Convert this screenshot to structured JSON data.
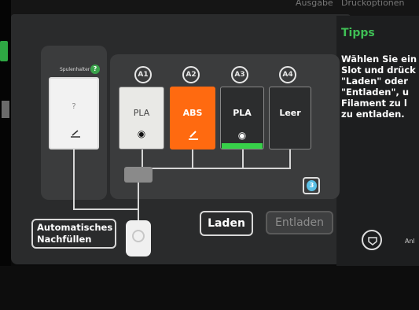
{
  "top": {
    "tab_left": "Ausgabe",
    "tab_right": "Druckoptionen"
  },
  "spool_holder": {
    "label": "Spulenhalter",
    "help": "?",
    "slot_label": "?"
  },
  "slots": [
    {
      "id": "A1",
      "material": "PLA",
      "icon": "eye-icon",
      "color": "#e9e9e6",
      "text_color": "#333333"
    },
    {
      "id": "A2",
      "material": "ABS",
      "icon": "pencil-icon",
      "color": "#ff6a10",
      "text_color": "#ffffff"
    },
    {
      "id": "A3",
      "material": "PLA",
      "icon": "eye-icon",
      "color": "#2c2d2e",
      "text_color": "#ffffff"
    },
    {
      "id": "A4",
      "material": "Leer",
      "icon": "",
      "color": "#2c2d2e",
      "text_color": "#ffffff"
    }
  ],
  "humidity_badge": "3",
  "buttons": {
    "auto_refill_line1": "Automatisches",
    "auto_refill_line2": "Nachfüllen",
    "load": "Laden",
    "unload": "Entladen"
  },
  "tips": {
    "title": "Tipps",
    "text": "Wählen Sie ein Slot und drück \"Laden\" oder \"Entladen\", u Filament zu l zu entladen."
  },
  "bottom_right": {
    "label": "Anl"
  },
  "colors": {
    "accent_green": "#3fbf55",
    "abs_orange": "#ff6a10",
    "panel": "#3b3c3d",
    "screen": "#2a2b2c"
  }
}
